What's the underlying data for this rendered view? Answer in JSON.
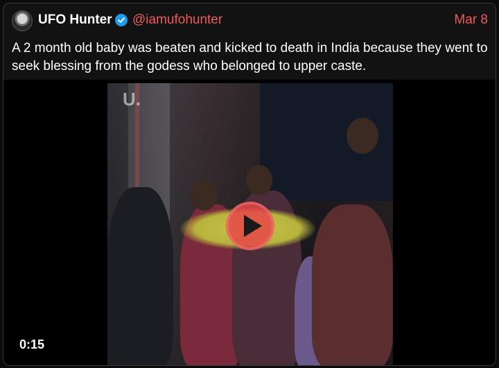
{
  "tweet": {
    "author_name": "UFO Hunter",
    "author_handle": "@iamufohunter",
    "date": "Mar 8",
    "text": "A 2 month old baby was beaten and kicked to death in India because they went to seek blessing from the godess who belonged to upper caste."
  },
  "video": {
    "duration": "0:15",
    "watermark": "U.",
    "play_icon": "play-icon"
  },
  "icons": {
    "avatar": "avatar-icon",
    "verified": "verified-badge-icon"
  },
  "colors": {
    "accent": "#f05a5a",
    "verified": "#1d9bf0",
    "background": "#121212",
    "border": "#3a3a3a",
    "play_button": "#e64646"
  }
}
